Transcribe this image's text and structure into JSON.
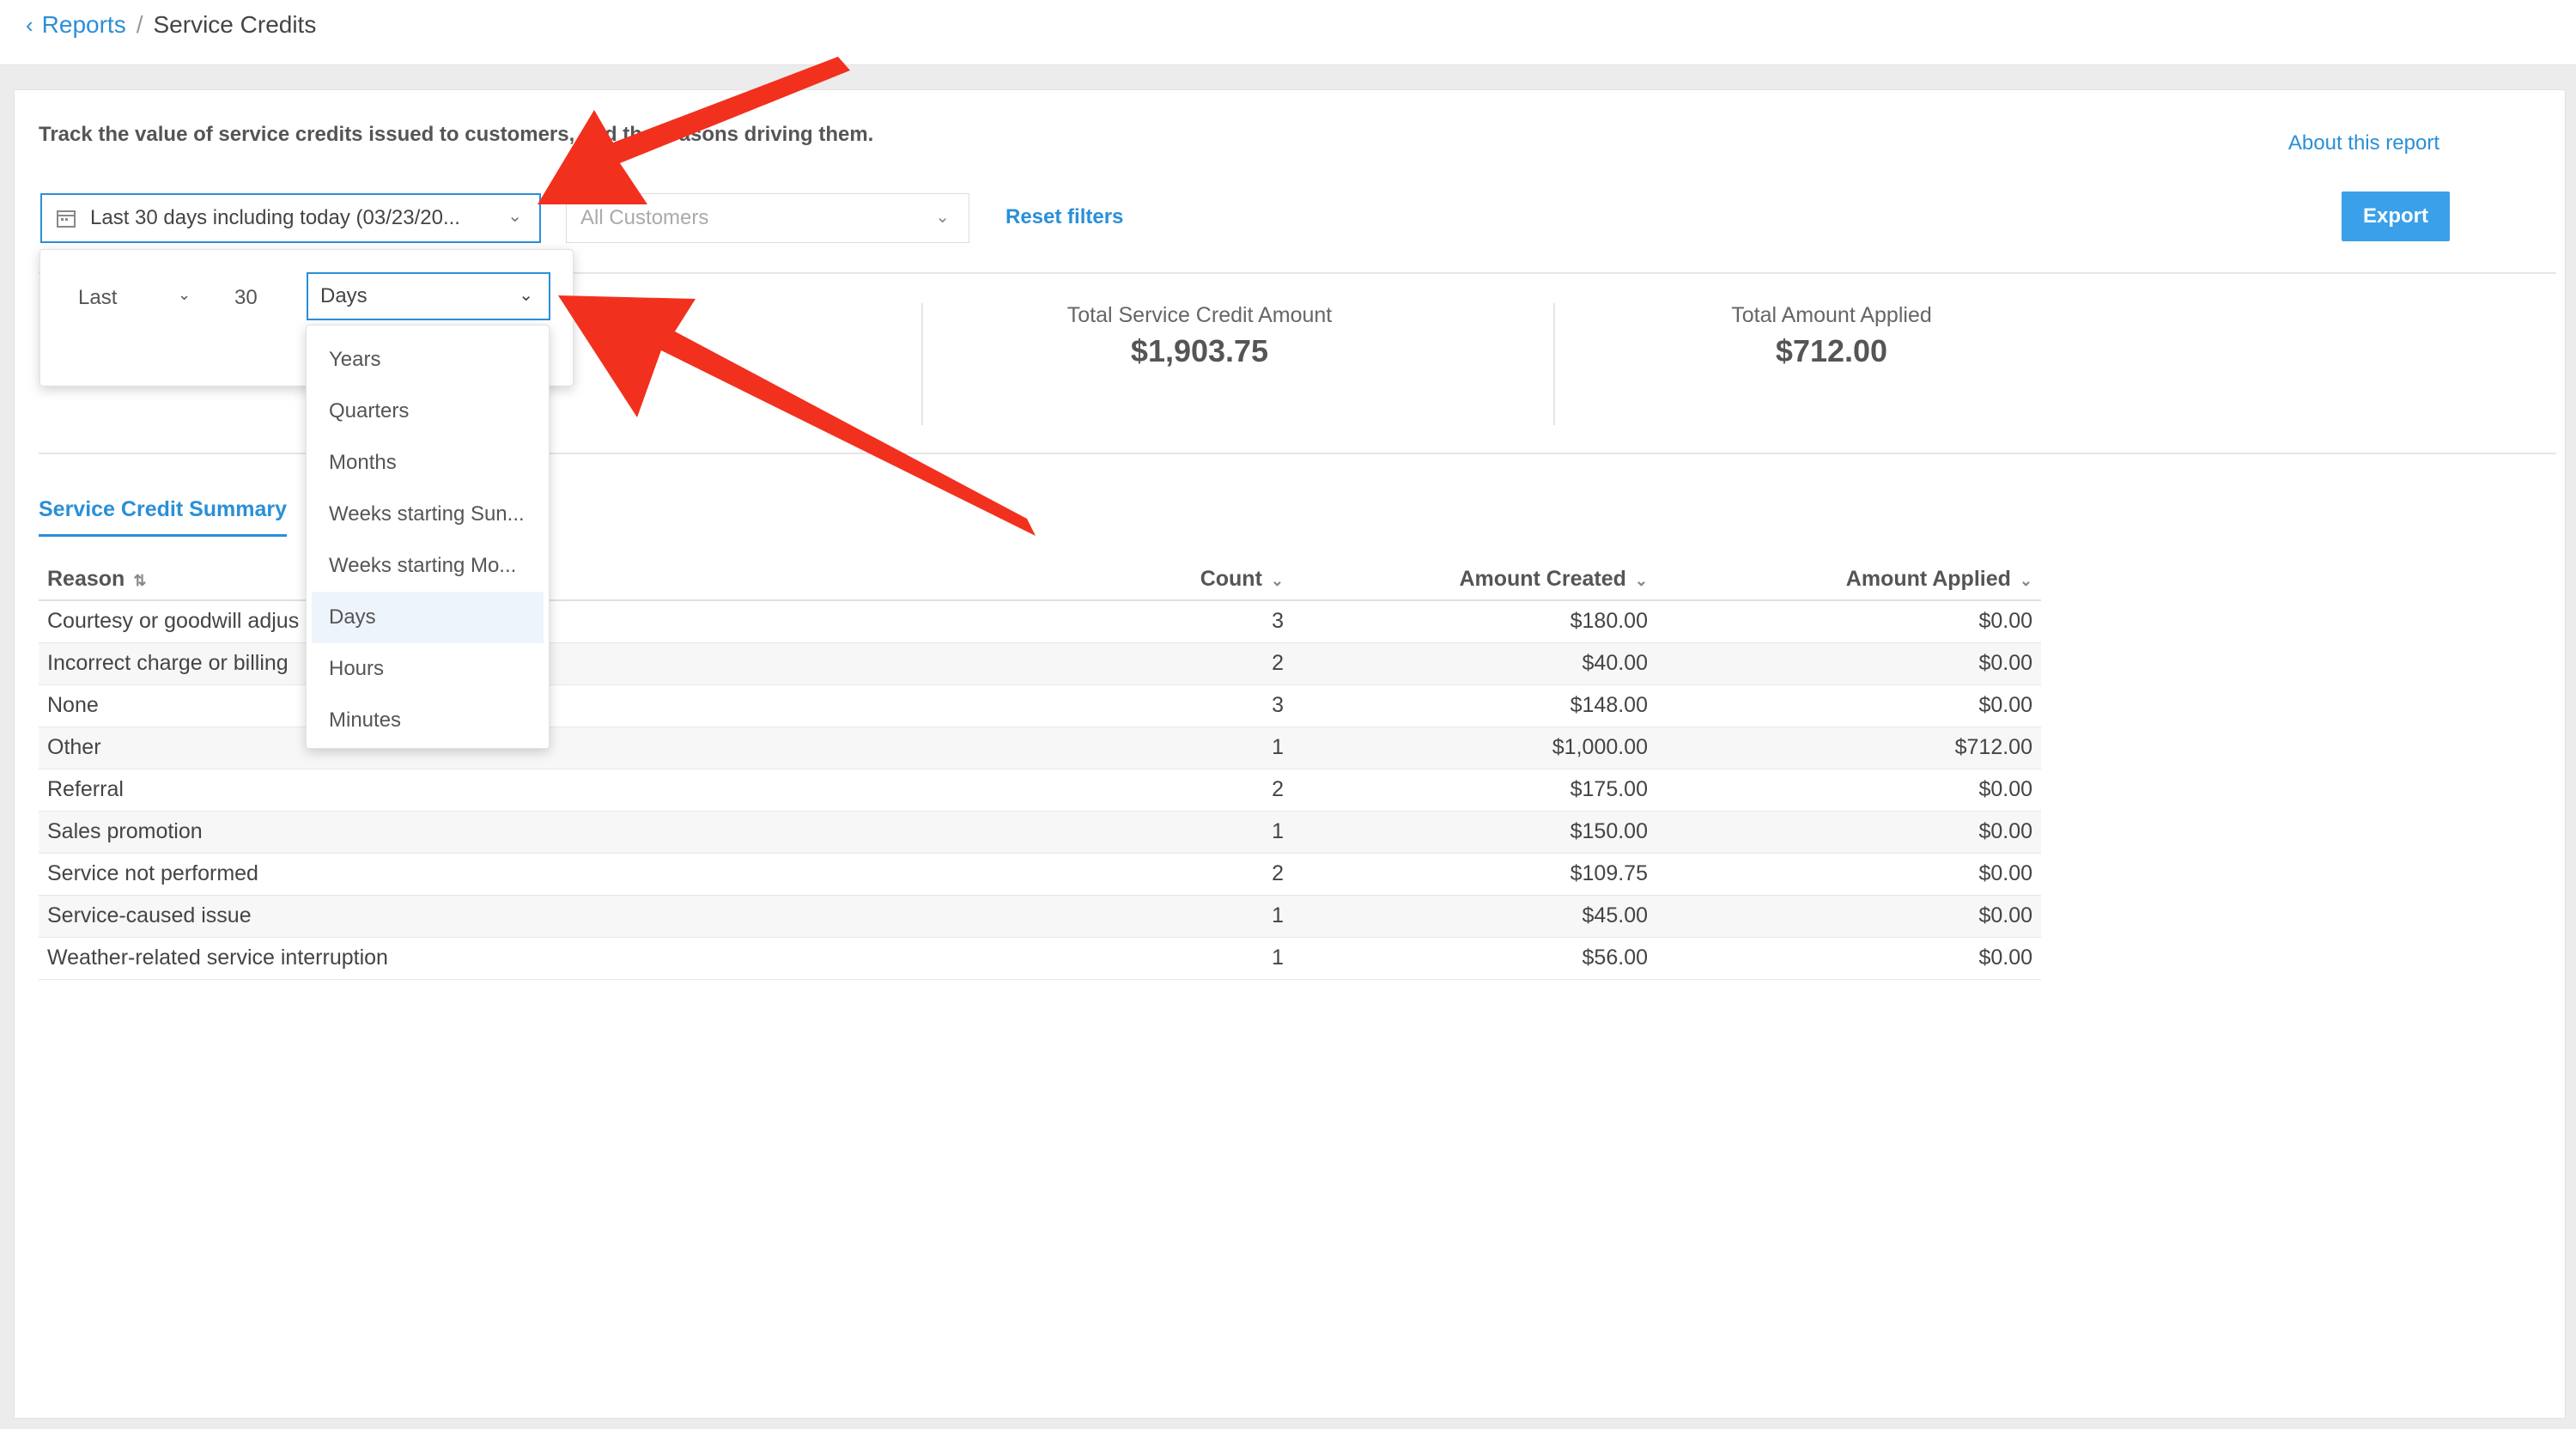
{
  "breadcrumb": {
    "parent": "Reports",
    "separator": "/",
    "current": "Service Credits"
  },
  "description": "Track the value of service credits issued to customers, and the reasons driving them.",
  "about_link": "About this report",
  "filters": {
    "date_range": "Last 30 days including today (03/23/20...",
    "customers_placeholder": "All Customers",
    "reset": "Reset filters"
  },
  "export_label": "Export",
  "stats": [
    {
      "label": "Total Service Credit Amount",
      "value": "$1,903.75"
    },
    {
      "label": "Total Amount Applied",
      "value": "$712.00"
    }
  ],
  "tab": "Service Credit Summary",
  "table": {
    "headers": {
      "reason": "Reason",
      "count": "Count",
      "amount_created": "Amount Created",
      "amount_applied": "Amount Applied"
    },
    "rows": [
      {
        "reason": "Courtesy or goodwill adjus",
        "count": "3",
        "created": "$180.00",
        "applied": "$0.00"
      },
      {
        "reason": "Incorrect charge or billing",
        "count": "2",
        "created": "$40.00",
        "applied": "$0.00"
      },
      {
        "reason": "None",
        "count": "3",
        "created": "$148.00",
        "applied": "$0.00"
      },
      {
        "reason": "Other",
        "count": "1",
        "created": "$1,000.00",
        "applied": "$712.00"
      },
      {
        "reason": "Referral",
        "count": "2",
        "created": "$175.00",
        "applied": "$0.00"
      },
      {
        "reason": "Sales promotion",
        "count": "1",
        "created": "$150.00",
        "applied": "$0.00"
      },
      {
        "reason": "Service not performed",
        "count": "2",
        "created": "$109.75",
        "applied": "$0.00"
      },
      {
        "reason": "Service-caused issue",
        "count": "1",
        "created": "$45.00",
        "applied": "$0.00"
      },
      {
        "reason": "Weather-related service interruption",
        "count": "1",
        "created": "$56.00",
        "applied": "$0.00"
      }
    ]
  },
  "popover": {
    "relative": "Last",
    "amount": "30",
    "unit": "Days"
  },
  "unit_options": [
    "Years",
    "Quarters",
    "Months",
    "Weeks starting Sun...",
    "Weeks starting Mo...",
    "Days",
    "Hours",
    "Minutes"
  ],
  "selected_unit": "Days",
  "colors": {
    "accent": "#2a8fd8",
    "arrow": "#f2301e",
    "button": "#3aa0ea"
  }
}
